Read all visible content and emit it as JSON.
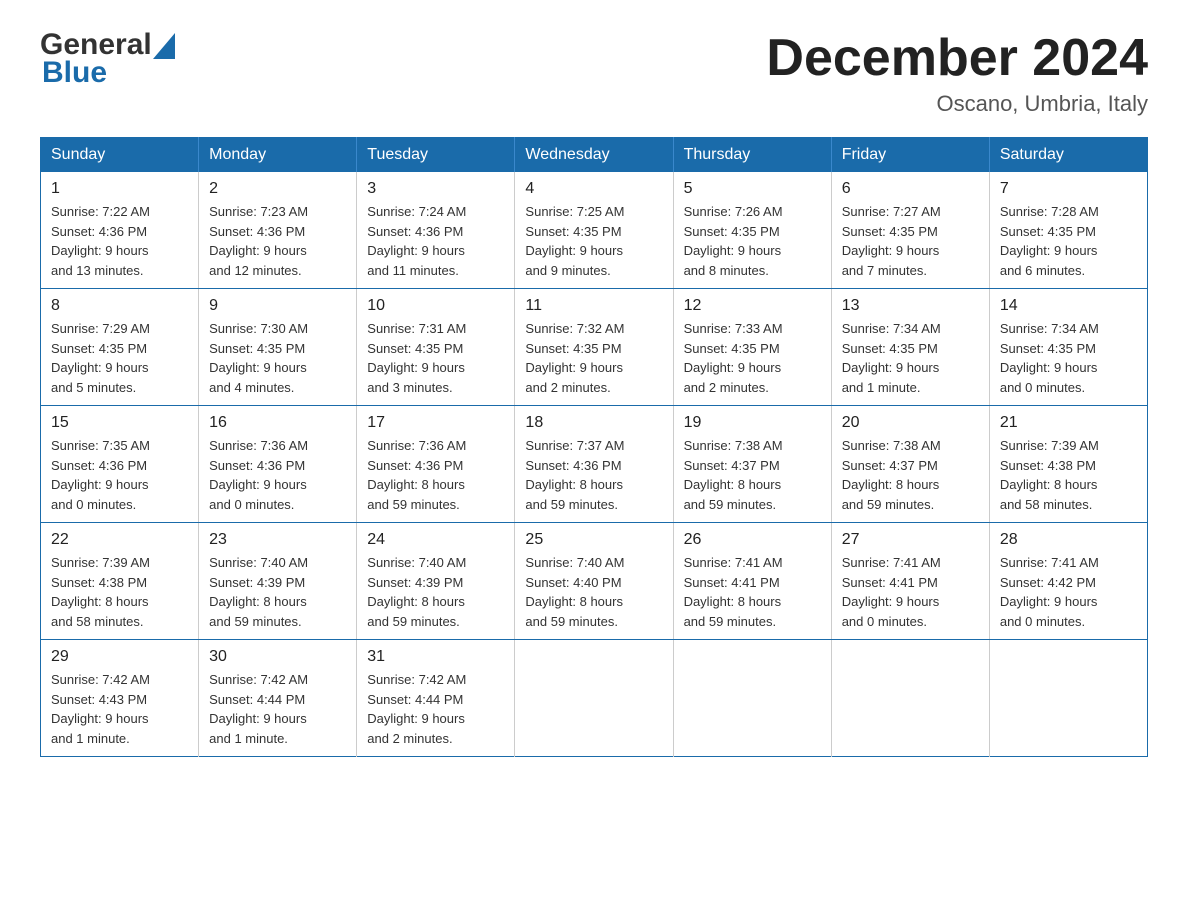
{
  "logo": {
    "general": "General",
    "blue": "Blue",
    "arrow_color": "#1a6baa"
  },
  "header": {
    "month_year": "December 2024",
    "location": "Oscano, Umbria, Italy"
  },
  "weekdays": [
    "Sunday",
    "Monday",
    "Tuesday",
    "Wednesday",
    "Thursday",
    "Friday",
    "Saturday"
  ],
  "weeks": [
    [
      {
        "day": "1",
        "sunrise": "7:22 AM",
        "sunset": "4:36 PM",
        "daylight": "9 hours and 13 minutes."
      },
      {
        "day": "2",
        "sunrise": "7:23 AM",
        "sunset": "4:36 PM",
        "daylight": "9 hours and 12 minutes."
      },
      {
        "day": "3",
        "sunrise": "7:24 AM",
        "sunset": "4:36 PM",
        "daylight": "9 hours and 11 minutes."
      },
      {
        "day": "4",
        "sunrise": "7:25 AM",
        "sunset": "4:35 PM",
        "daylight": "9 hours and 9 minutes."
      },
      {
        "day": "5",
        "sunrise": "7:26 AM",
        "sunset": "4:35 PM",
        "daylight": "9 hours and 8 minutes."
      },
      {
        "day": "6",
        "sunrise": "7:27 AM",
        "sunset": "4:35 PM",
        "daylight": "9 hours and 7 minutes."
      },
      {
        "day": "7",
        "sunrise": "7:28 AM",
        "sunset": "4:35 PM",
        "daylight": "9 hours and 6 minutes."
      }
    ],
    [
      {
        "day": "8",
        "sunrise": "7:29 AM",
        "sunset": "4:35 PM",
        "daylight": "9 hours and 5 minutes."
      },
      {
        "day": "9",
        "sunrise": "7:30 AM",
        "sunset": "4:35 PM",
        "daylight": "9 hours and 4 minutes."
      },
      {
        "day": "10",
        "sunrise": "7:31 AM",
        "sunset": "4:35 PM",
        "daylight": "9 hours and 3 minutes."
      },
      {
        "day": "11",
        "sunrise": "7:32 AM",
        "sunset": "4:35 PM",
        "daylight": "9 hours and 2 minutes."
      },
      {
        "day": "12",
        "sunrise": "7:33 AM",
        "sunset": "4:35 PM",
        "daylight": "9 hours and 2 minutes."
      },
      {
        "day": "13",
        "sunrise": "7:34 AM",
        "sunset": "4:35 PM",
        "daylight": "9 hours and 1 minute."
      },
      {
        "day": "14",
        "sunrise": "7:34 AM",
        "sunset": "4:35 PM",
        "daylight": "9 hours and 0 minutes."
      }
    ],
    [
      {
        "day": "15",
        "sunrise": "7:35 AM",
        "sunset": "4:36 PM",
        "daylight": "9 hours and 0 minutes."
      },
      {
        "day": "16",
        "sunrise": "7:36 AM",
        "sunset": "4:36 PM",
        "daylight": "9 hours and 0 minutes."
      },
      {
        "day": "17",
        "sunrise": "7:36 AM",
        "sunset": "4:36 PM",
        "daylight": "8 hours and 59 minutes."
      },
      {
        "day": "18",
        "sunrise": "7:37 AM",
        "sunset": "4:36 PM",
        "daylight": "8 hours and 59 minutes."
      },
      {
        "day": "19",
        "sunrise": "7:38 AM",
        "sunset": "4:37 PM",
        "daylight": "8 hours and 59 minutes."
      },
      {
        "day": "20",
        "sunrise": "7:38 AM",
        "sunset": "4:37 PM",
        "daylight": "8 hours and 59 minutes."
      },
      {
        "day": "21",
        "sunrise": "7:39 AM",
        "sunset": "4:38 PM",
        "daylight": "8 hours and 58 minutes."
      }
    ],
    [
      {
        "day": "22",
        "sunrise": "7:39 AM",
        "sunset": "4:38 PM",
        "daylight": "8 hours and 58 minutes."
      },
      {
        "day": "23",
        "sunrise": "7:40 AM",
        "sunset": "4:39 PM",
        "daylight": "8 hours and 59 minutes."
      },
      {
        "day": "24",
        "sunrise": "7:40 AM",
        "sunset": "4:39 PM",
        "daylight": "8 hours and 59 minutes."
      },
      {
        "day": "25",
        "sunrise": "7:40 AM",
        "sunset": "4:40 PM",
        "daylight": "8 hours and 59 minutes."
      },
      {
        "day": "26",
        "sunrise": "7:41 AM",
        "sunset": "4:41 PM",
        "daylight": "8 hours and 59 minutes."
      },
      {
        "day": "27",
        "sunrise": "7:41 AM",
        "sunset": "4:41 PM",
        "daylight": "9 hours and 0 minutes."
      },
      {
        "day": "28",
        "sunrise": "7:41 AM",
        "sunset": "4:42 PM",
        "daylight": "9 hours and 0 minutes."
      }
    ],
    [
      {
        "day": "29",
        "sunrise": "7:42 AM",
        "sunset": "4:43 PM",
        "daylight": "9 hours and 1 minute."
      },
      {
        "day": "30",
        "sunrise": "7:42 AM",
        "sunset": "4:44 PM",
        "daylight": "9 hours and 1 minute."
      },
      {
        "day": "31",
        "sunrise": "7:42 AM",
        "sunset": "4:44 PM",
        "daylight": "9 hours and 2 minutes."
      },
      null,
      null,
      null,
      null
    ]
  ],
  "labels": {
    "sunrise": "Sunrise:",
    "sunset": "Sunset:",
    "daylight": "Daylight:"
  }
}
